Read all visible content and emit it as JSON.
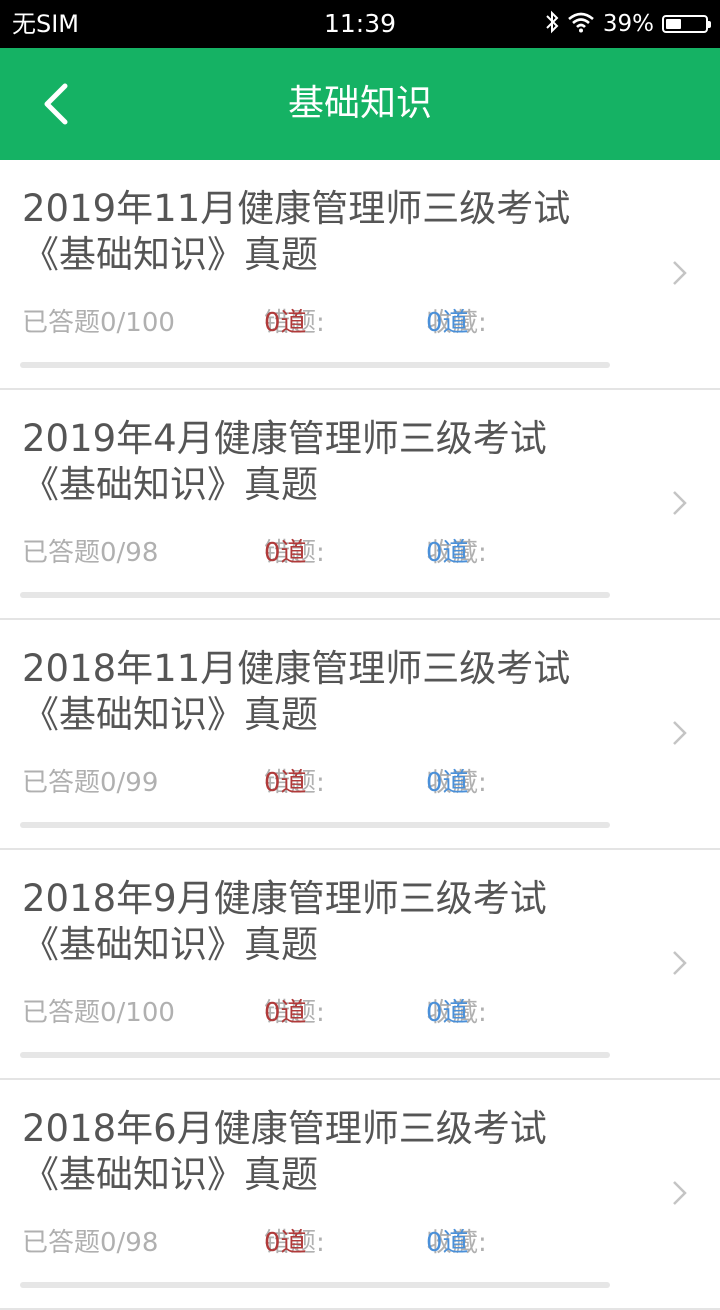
{
  "status_bar": {
    "carrier": "无SIM",
    "time": "11:39",
    "battery_pct": "39%",
    "battery_level": 0.39
  },
  "nav": {
    "title": "基础知识",
    "back_icon": "chevron-left-icon"
  },
  "colors": {
    "nav_green": "#15b264",
    "wrong_red": "#b03a3a",
    "fav_blue": "#4a90d9"
  },
  "items": [
    {
      "title_line1": "2019年11月健康管理师三级考试",
      "title_line2": "《基础知识》真题",
      "answered": "已答题0/100",
      "wrong_label": "错题:",
      "wrong_value": "0道",
      "fav_label": "收藏:",
      "fav_value": "0道",
      "progress": 0
    },
    {
      "title_line1": "2019年4月健康管理师三级考试",
      "title_line2": "《基础知识》真题",
      "answered": "已答题0/98",
      "wrong_label": "错题:",
      "wrong_value": "0道",
      "fav_label": "收藏:",
      "fav_value": "0道",
      "progress": 0
    },
    {
      "title_line1": "2018年11月健康管理师三级考试",
      "title_line2": "《基础知识》真题",
      "answered": "已答题0/99",
      "wrong_label": "错题:",
      "wrong_value": "0道",
      "fav_label": "收藏:",
      "fav_value": "0道",
      "progress": 0
    },
    {
      "title_line1": "2018年9月健康管理师三级考试",
      "title_line2": "《基础知识》真题",
      "answered": "已答题0/100",
      "wrong_label": "错题:",
      "wrong_value": "0道",
      "fav_label": "收藏:",
      "fav_value": "0道",
      "progress": 0
    },
    {
      "title_line1": "2018年6月健康管理师三级考试",
      "title_line2": "《基础知识》真题",
      "answered": "已答题0/98",
      "wrong_label": "错题:",
      "wrong_value": "0道",
      "fav_label": "收藏:",
      "fav_value": "0道",
      "progress": 0
    }
  ]
}
